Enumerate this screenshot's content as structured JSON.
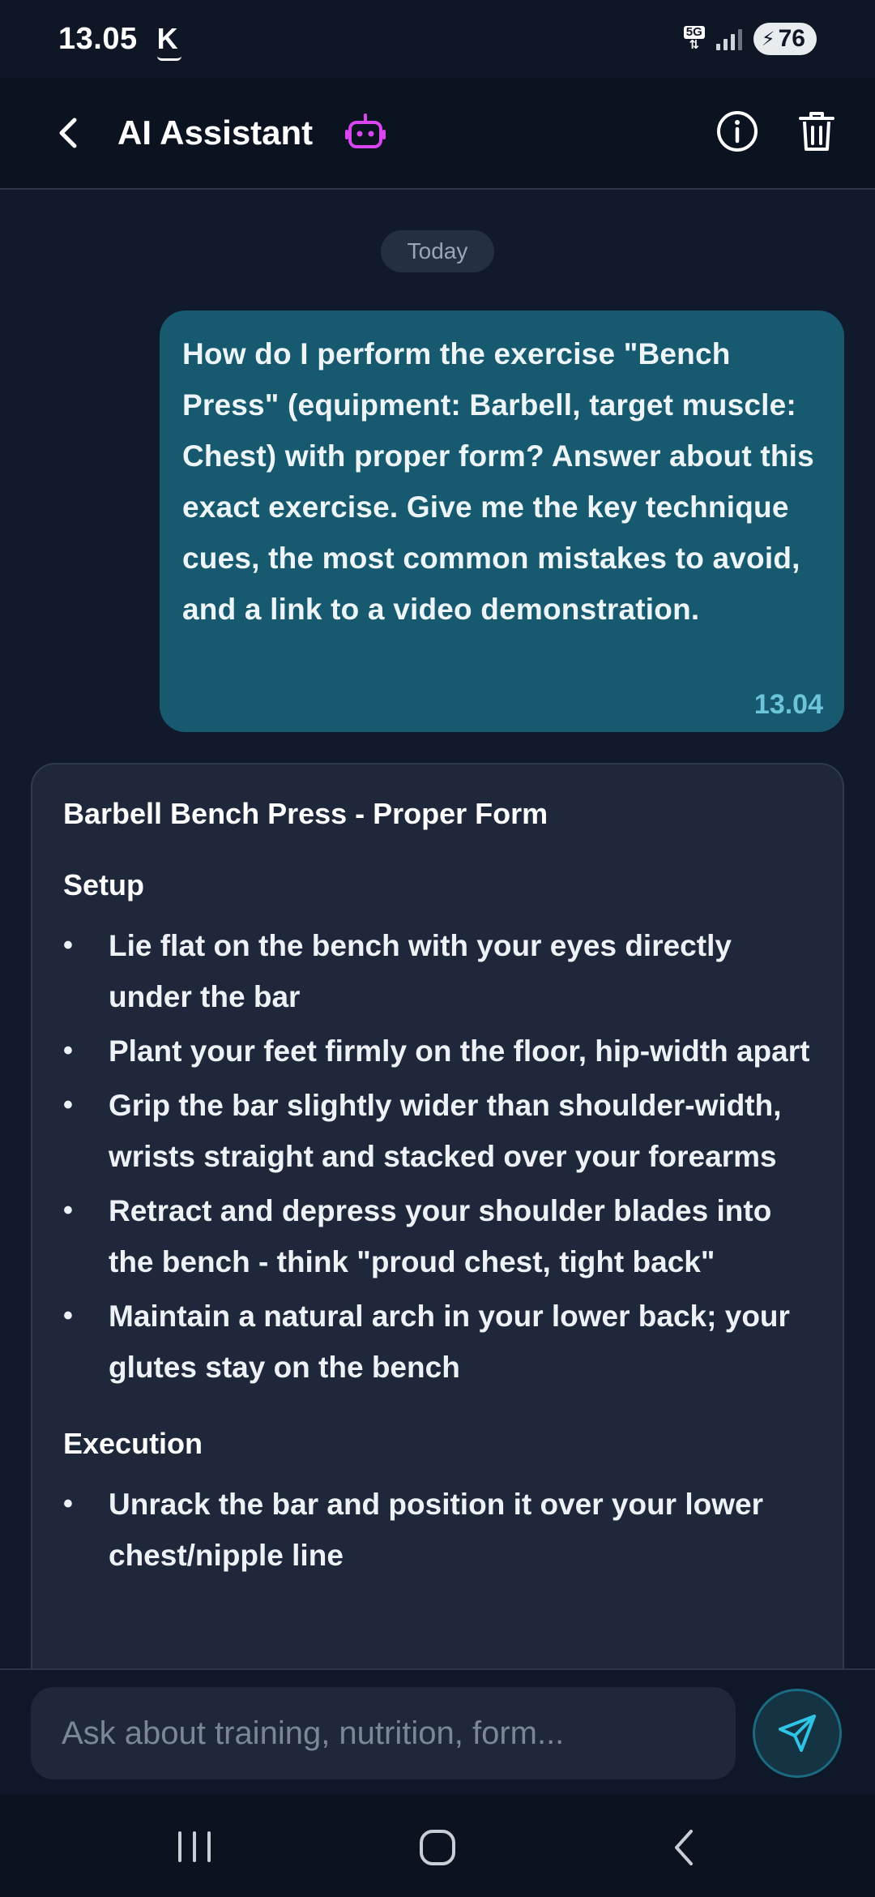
{
  "status_bar": {
    "time": "13.05",
    "carrier_icon": "K",
    "network_label": "5G",
    "battery_level": "76"
  },
  "header": {
    "title": "AI Assistant",
    "back_icon": "chevron-left-icon",
    "title_icon": "robot-icon",
    "info_icon": "info-icon",
    "delete_icon": "trash-icon"
  },
  "chat": {
    "date_label": "Today",
    "user_message": {
      "text": "How do I perform the exercise \"Bench Press\" (equipment: Barbell, target muscle: Chest) with proper form? Answer about this exact exercise. Give me the key technique cues, the most common mistakes to avoid, and a link to a video demonstration.",
      "time": "13.04"
    },
    "ai_message": {
      "title": "Barbell Bench Press - Proper Form",
      "sections": [
        {
          "heading": "Setup",
          "items": [
            "Lie flat on the bench with your eyes directly under the bar",
            "Plant your feet firmly on the floor, hip-width apart",
            "Grip the bar slightly wider than shoulder-width, wrists straight and stacked over your forearms",
            "Retract and depress your shoulder blades into the bench - think \"proud chest, tight back\"",
            "Maintain a natural arch in your lower back; your glutes stay on the bench"
          ]
        },
        {
          "heading": "Execution",
          "items": [
            "Unrack the bar and position it over your lower chest/nipple line"
          ]
        }
      ]
    }
  },
  "input": {
    "placeholder": "Ask about training, nutrition, form...",
    "value": "",
    "send_icon": "send-icon"
  },
  "nav": {
    "recent_icon": "recent-apps-icon",
    "home_icon": "home-icon",
    "back_icon": "back-icon"
  },
  "colors": {
    "background": "#111a2c",
    "header": "#0b1220",
    "user_bubble": "#17596f",
    "ai_card": "#1e283a",
    "accent": "#d946ef",
    "timestamp": "#6cc4d9"
  }
}
